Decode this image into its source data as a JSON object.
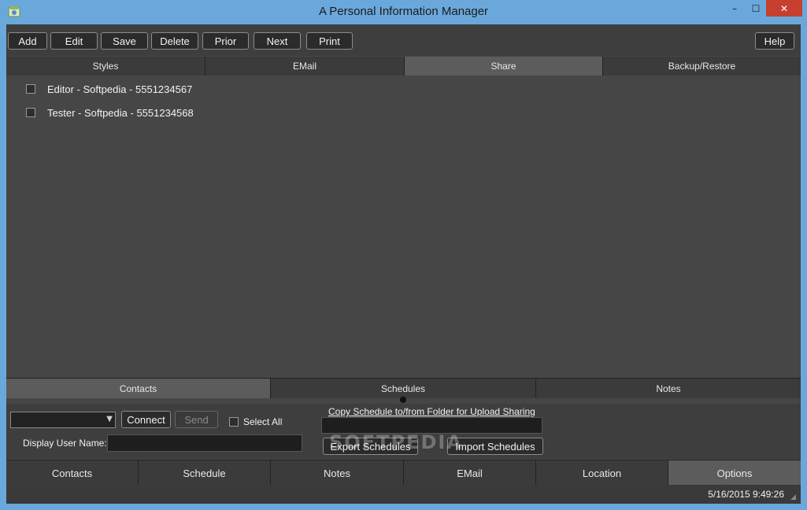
{
  "window": {
    "title": "A Personal Information Manager",
    "controls": {
      "minimize": "–",
      "maximize": "☐",
      "close": "✕"
    },
    "colors": {
      "frame": "#6aa8dc",
      "client": "#464646",
      "close": "#c7402f"
    }
  },
  "toolbar": {
    "add": "Add",
    "edit": "Edit",
    "save": "Save",
    "delete": "Delete",
    "prior": "Prior",
    "next": "Next",
    "print": "Print",
    "help": "Help"
  },
  "top_tabs": [
    {
      "label": "Styles",
      "active": false
    },
    {
      "label": "EMail",
      "active": false
    },
    {
      "label": "Share",
      "active": true
    },
    {
      "label": "Backup/Restore",
      "active": false
    }
  ],
  "share_list": [
    {
      "label": "Editor - Softpedia - 5551234567",
      "checked": false
    },
    {
      "label": "Tester - Softpedia - 5551234568",
      "checked": false
    }
  ],
  "mid_tabs": [
    {
      "label": "Contacts",
      "active": true
    },
    {
      "label": "Schedules",
      "active": false
    },
    {
      "label": "Notes",
      "active": false
    }
  ],
  "share_panel": {
    "combo_value": "",
    "connect": "Connect",
    "send": "Send",
    "select_all": "Select All",
    "display_user_name_label": "Display User Name:",
    "display_user_name_value": "",
    "copy_link": "Copy Schedule to/from Folder for Upload Sharing",
    "folder_value": "",
    "export": "Export Schedules",
    "import": "Import Schedules"
  },
  "watermark": "SOFTPEDIA",
  "bottom_tabs": [
    {
      "label": "Contacts",
      "active": false
    },
    {
      "label": "Schedule",
      "active": false
    },
    {
      "label": "Notes",
      "active": false
    },
    {
      "label": "EMail",
      "active": false
    },
    {
      "label": "Location",
      "active": false
    },
    {
      "label": "Options",
      "active": true
    }
  ],
  "status": {
    "datetime": "5/16/2015 9:49:26"
  }
}
